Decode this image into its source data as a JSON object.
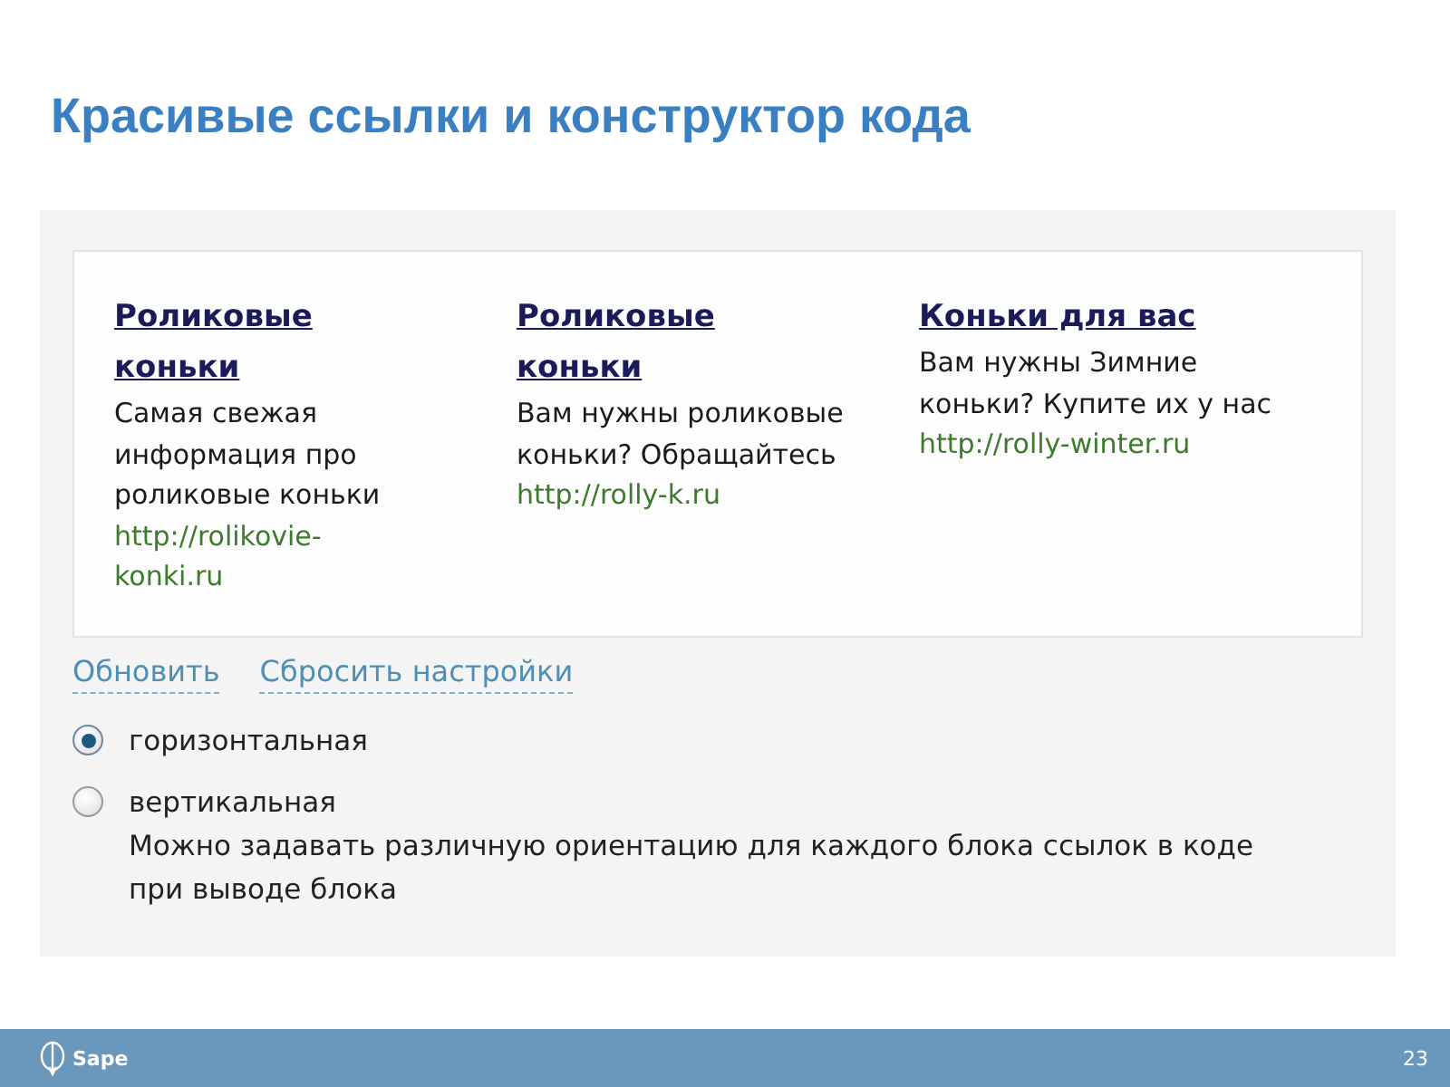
{
  "title": "Красивые ссылки и конструктор кода",
  "ads": [
    {
      "headline": "Роликовые коньки",
      "text": "Самая свежая информация про роликовые коньки",
      "url": "http://rolikovie-konki.ru"
    },
    {
      "headline": "Роликовые коньки",
      "text": "Вам нужны роликовые коньки? Обращайтесь",
      "url": "http://rolly-k.ru"
    },
    {
      "headline": "Коньки для вас",
      "text": "Вам нужны Зимние коньки? Купите их у нас",
      "url": "http://rolly-winter.ru"
    }
  ],
  "actions": [
    "Обновить",
    "Сбросить настройки"
  ],
  "orientation": [
    {
      "label": "горизонтальная",
      "selected": true
    },
    {
      "label": "вертикальная",
      "selected": false,
      "hint": "Можно задавать различную ориентацию для каждого блока ссылок в коде при выводе блока"
    }
  ],
  "footer": {
    "logo": "Sape",
    "page": "23"
  }
}
